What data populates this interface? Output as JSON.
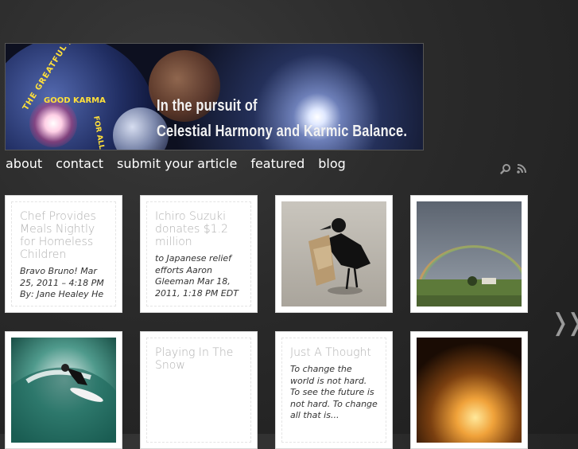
{
  "banner": {
    "logo_title": "THE GREATFUL JUDGE",
    "logo_karma": "GOOD KARMA",
    "logo_forall": "FOR ALL",
    "tagline_line1": "In the pursuit of",
    "tagline_line2": "Celestial Harmony and Karmic Balance."
  },
  "nav": {
    "items": [
      {
        "label": "about"
      },
      {
        "label": "contact"
      },
      {
        "label": "submit your article"
      },
      {
        "label": "featured"
      },
      {
        "label": "blog"
      }
    ]
  },
  "icons": {
    "search": "search-icon",
    "rss": "rss-icon"
  },
  "cards": {
    "c1": {
      "title": "Chef Provides Meals Nightly for Homeless Children",
      "excerpt": "Bravo Bruno! Mar 25, 2011 – 4:18 PM By: Jane Healey He"
    },
    "c2": {
      "title": "Ichiro Suzuki donates $1.2 million",
      "excerpt": "to Japanese relief efforts Aaron Gleeman Mar 18, 2011, 1:18 PM EDT"
    },
    "c6": {
      "title": "Playing In The Snow"
    },
    "c7": {
      "title": "Just A Thought",
      "excerpt": "To change the world is not hard. To see the future is not hard. To change all that is..."
    }
  },
  "pager": {
    "next_label": "❭❭"
  },
  "colors": {
    "background": "#2a2a2a",
    "card": "#ffffff",
    "title_grey": "#b0b0b0"
  }
}
